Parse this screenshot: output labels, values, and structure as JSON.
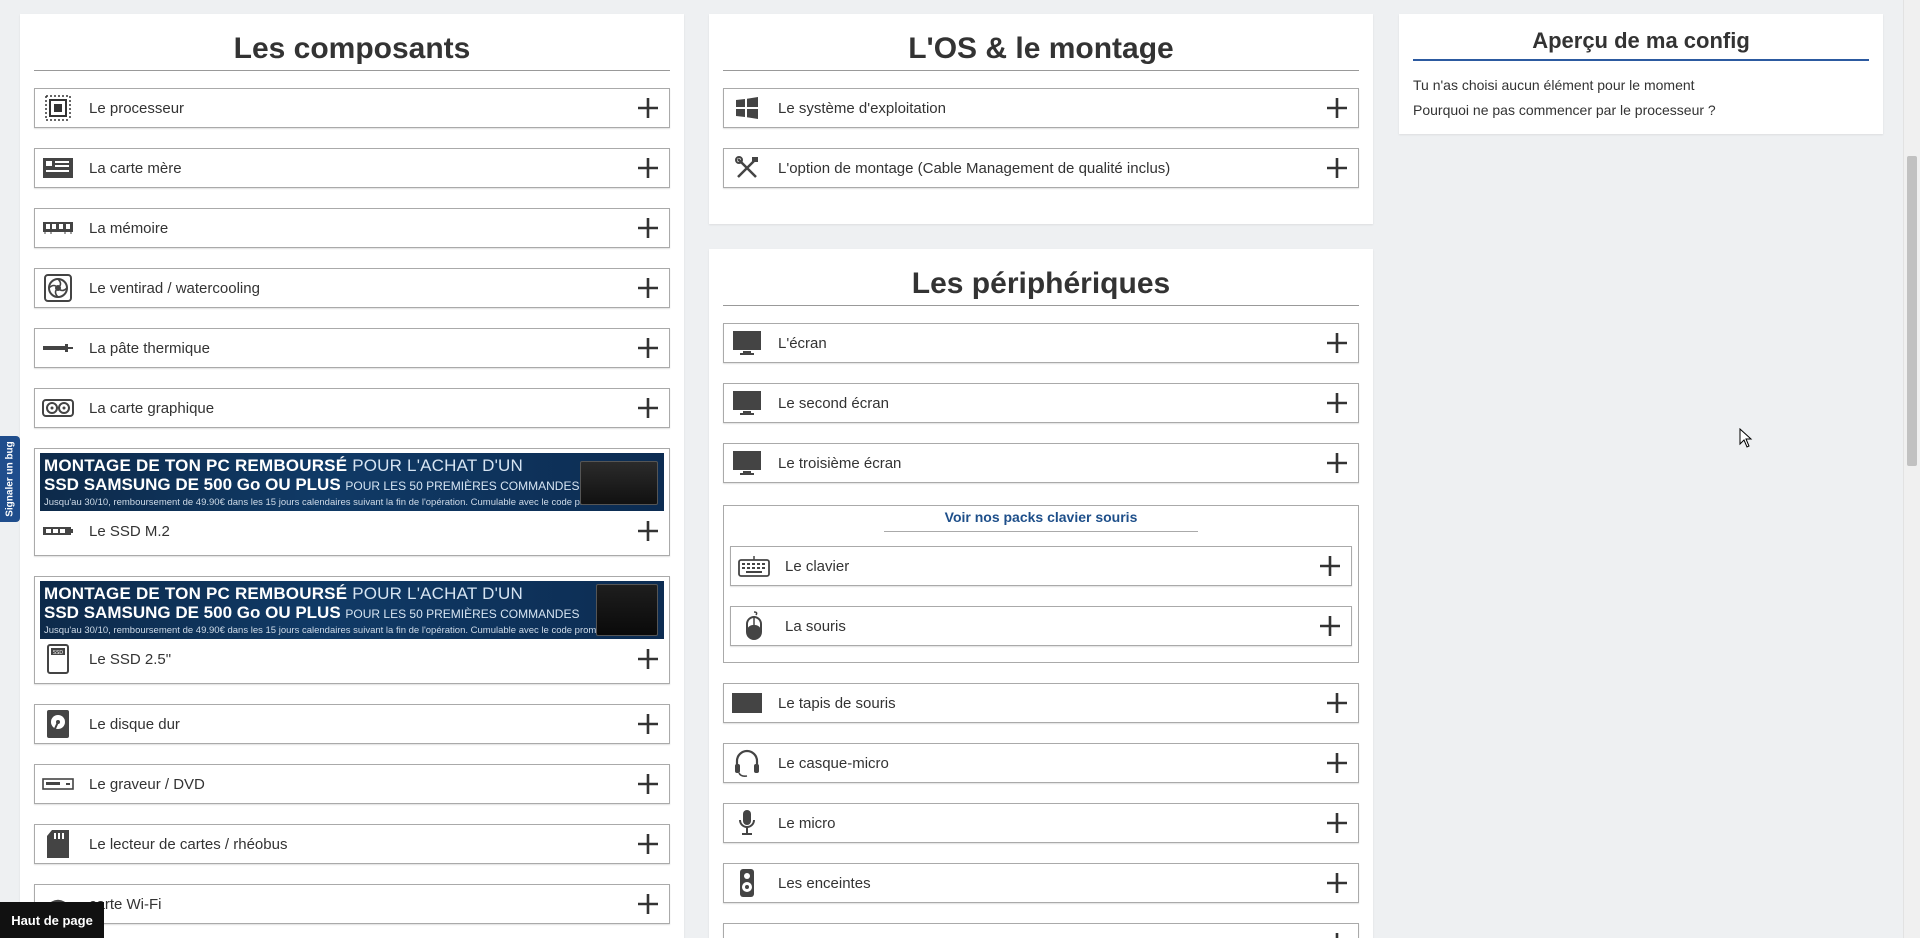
{
  "components": {
    "title": "Les composants",
    "items": [
      {
        "label": "Le processeur",
        "icon": "cpu-icon"
      },
      {
        "label": "La carte mère",
        "icon": "motherboard-icon"
      },
      {
        "label": "La mémoire",
        "icon": "ram-icon"
      },
      {
        "label": "Le ventirad / watercooling",
        "icon": "fan-icon"
      },
      {
        "label": "La pâte thermique",
        "icon": "thermal-paste-icon"
      },
      {
        "label": "La carte graphique",
        "icon": "gpu-icon"
      }
    ],
    "promo_items": [
      {
        "label": "Le SSD M.2",
        "icon": "ssd-m2-icon",
        "banner": {
          "line1_a": "MONTAGE DE TON PC",
          "line1_b": "REMBOURSÉ",
          "line1_c": "POUR L'ACHAT D'UN",
          "line2_a": "SSD",
          "line2_b": "SAMSUNG",
          "line2_c": "DE 500 Go OU PLUS",
          "line2_d": "POUR LES 50 PREMIÈRES COMMANDES",
          "line3": "Jusqu'au 30/10, remboursement de 49.90€ dans les 15 jours calendaires suivant la fin de l'opération. Cumulable avec le code promo."
        }
      },
      {
        "label": "Le SSD 2.5\"",
        "icon": "ssd-25-icon",
        "banner": {
          "line1_a": "MONTAGE DE TON PC",
          "line1_b": "REMBOURSÉ",
          "line1_c": "POUR L'ACHAT D'UN",
          "line2_a": "SSD",
          "line2_b": "SAMSUNG",
          "line2_c": "DE 500 Go OU PLUS",
          "line2_d": "POUR LES 50 PREMIÈRES COMMANDES",
          "line3": "Jusqu'au 30/10, remboursement de 49.90€ dans les 15 jours calendaires suivant la fin de l'opération. Cumulable avec le code promo."
        }
      }
    ],
    "items_after": [
      {
        "label": "Le disque dur",
        "icon": "hdd-icon"
      },
      {
        "label": "Le graveur / DVD",
        "icon": "dvd-drive-icon"
      },
      {
        "label": "Le lecteur de cartes / rhéobus",
        "icon": "sd-card-icon"
      },
      {
        "label": "carte Wi-Fi",
        "icon": "wifi-card-icon"
      }
    ]
  },
  "os": {
    "title": "L'OS & le montage",
    "items": [
      {
        "label": "Le système d'exploitation",
        "icon": "windows-icon"
      },
      {
        "label": "L'option de montage (Cable Management de qualité inclus)",
        "icon": "tools-icon"
      }
    ]
  },
  "peripherals": {
    "title": "Les périphériques",
    "items_before": [
      {
        "label": "L'écran",
        "icon": "monitor-icon"
      },
      {
        "label": "Le second écran",
        "icon": "monitor-icon"
      },
      {
        "label": "Le troisième écran",
        "icon": "monitor-icon"
      }
    ],
    "pack_link": "Voir nos packs clavier souris",
    "pack_items": [
      {
        "label": "Le clavier",
        "icon": "keyboard-icon"
      },
      {
        "label": "La souris",
        "icon": "mouse-icon"
      }
    ],
    "items_after": [
      {
        "label": "Le tapis de souris",
        "icon": "mousepad-icon"
      },
      {
        "label": "Le casque-micro",
        "icon": "headset-icon"
      },
      {
        "label": "Le micro",
        "icon": "microphone-icon"
      },
      {
        "label": "Les enceintes",
        "icon": "speaker-icon"
      }
    ]
  },
  "preview": {
    "title": "Aperçu de ma config",
    "line1": "Tu n'as choisi aucun élément pour le moment",
    "line2": "Pourquoi ne pas commencer par le processeur ?"
  },
  "bug_tab": "Signaler un bug",
  "back_to_top": "Haut de page",
  "colors": {
    "accent": "#1f4d8c",
    "link": "#1e4f8a",
    "banner": "#0d2a4a"
  }
}
